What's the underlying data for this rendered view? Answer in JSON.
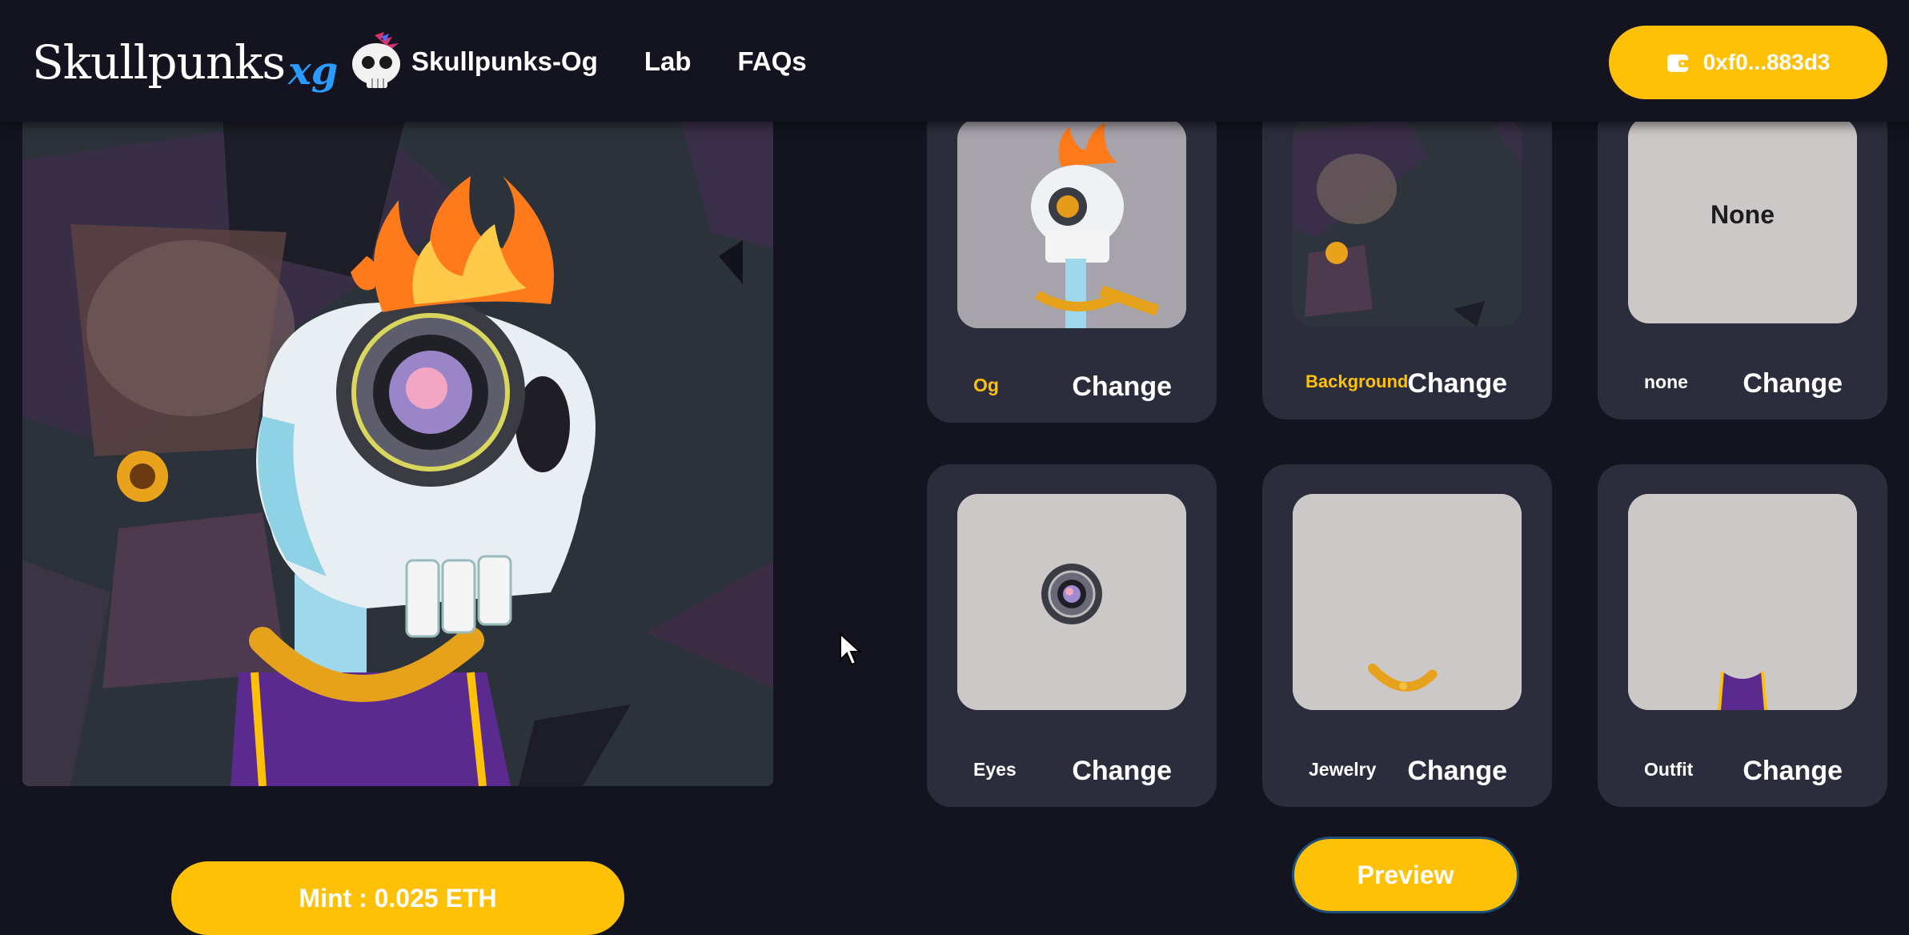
{
  "header": {
    "logo_text": "Skullpunks",
    "logo_suffix": "xg",
    "nav": [
      "Skullpunks-Og",
      "Lab",
      "FAQs"
    ],
    "wallet_address": "0xf0...883d3"
  },
  "traits": [
    {
      "label": "Og",
      "action": "Change",
      "highlight": true
    },
    {
      "label": "Background",
      "action": "Change",
      "highlight": true
    },
    {
      "label": "none",
      "action": "Change",
      "highlight": false,
      "thumb_text": "None"
    },
    {
      "label": "Eyes",
      "action": "Change",
      "highlight": false
    },
    {
      "label": "Jewelry",
      "action": "Change",
      "highlight": false
    },
    {
      "label": "Outfit",
      "action": "Change",
      "highlight": false
    }
  ],
  "mint_button": "Mint : 0.025 ETH",
  "preview_button": "Preview",
  "colors": {
    "background": "#13141f",
    "card": "#2c2d3c",
    "accent": "#ffc107",
    "thumb": "#cdc8c8"
  }
}
